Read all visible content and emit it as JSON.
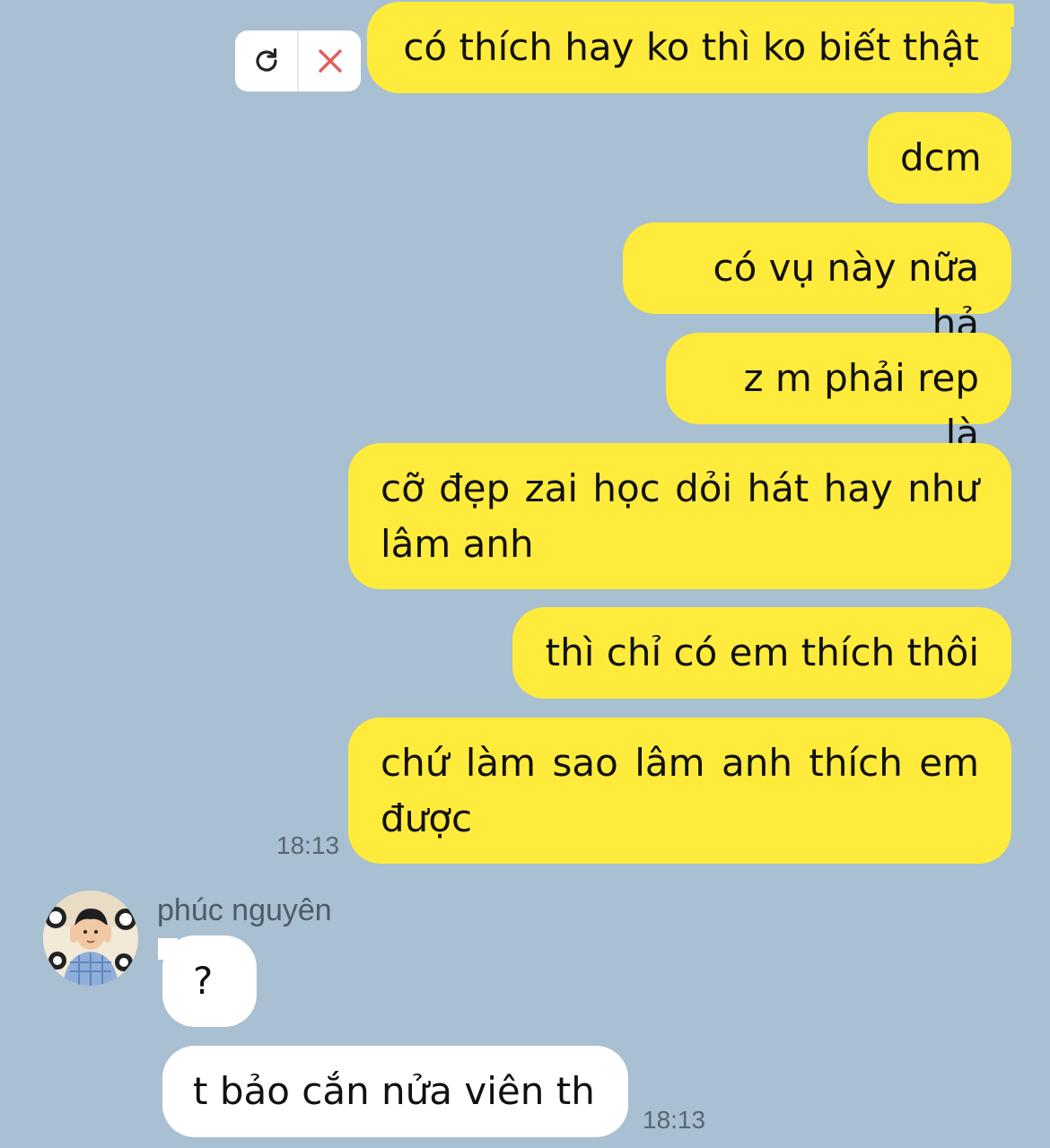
{
  "conversation": {
    "failed_actions": {
      "retry_icon": "refresh-icon",
      "cancel_icon": "close-icon"
    },
    "sent_messages": [
      "có thích hay ko thì ko biết thật",
      "dcm",
      "có vụ này nữa hả",
      "z m phải rep là",
      "cỡ đẹp zai học dỏi hát hay như lâm anh",
      "thì chỉ có em thích thôi",
      "chứ làm sao lâm anh thích em được"
    ],
    "sent_time": "18:13",
    "contact": {
      "name": "phúc nguyên",
      "avatar_icon": "avatar"
    },
    "received_messages": [
      "?",
      "t bảo cắn nửa viên th"
    ],
    "received_time": "18:13"
  },
  "colors": {
    "background": "#a9bfd2",
    "sent_bubble": "#ffeb3b",
    "received_bubble": "#ffffff",
    "cancel_icon": "#e25c5c"
  }
}
